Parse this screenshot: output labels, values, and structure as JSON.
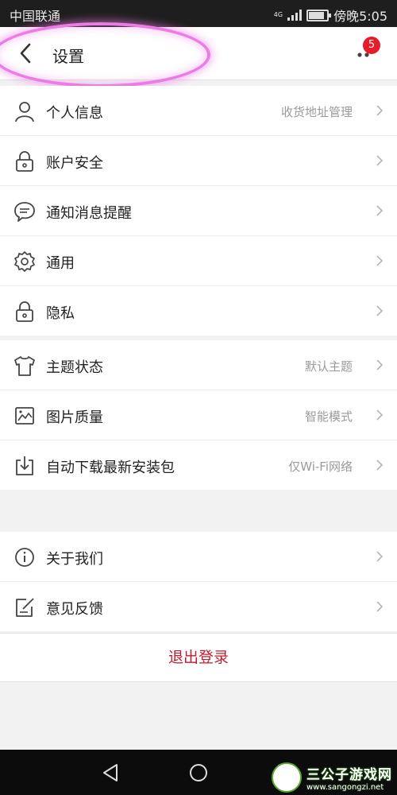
{
  "status_bar": {
    "carrier": "中国联通",
    "signal": "4G",
    "time": "傍晚5:05"
  },
  "header": {
    "title": "设置",
    "badge_count": "5"
  },
  "groups": [
    {
      "items": [
        {
          "icon": "person-icon",
          "label": "个人信息",
          "value": "收货地址管理"
        },
        {
          "icon": "lock-icon",
          "label": "账户安全",
          "value": ""
        },
        {
          "icon": "chat-bubble-icon",
          "label": "通知消息提醒",
          "value": ""
        },
        {
          "icon": "gear-icon",
          "label": "通用",
          "value": ""
        },
        {
          "icon": "lock-icon",
          "label": "隐私",
          "value": ""
        }
      ]
    },
    {
      "items": [
        {
          "icon": "tshirt-icon",
          "label": "主题状态",
          "value": "默认主题"
        },
        {
          "icon": "image-icon",
          "label": "图片质量",
          "value": "智能模式"
        },
        {
          "icon": "download-icon",
          "label": "自动下载最新安装包",
          "value": "仅Wi-Fi网络"
        }
      ]
    },
    {
      "items": [
        {
          "icon": "info-icon",
          "label": "关于我们",
          "value": ""
        },
        {
          "icon": "feedback-edit-icon",
          "label": "意见反馈",
          "value": ""
        }
      ]
    }
  ],
  "logout_label": "退出登录",
  "watermark": {
    "name": "三公子游戏网",
    "url": "www.sangongzi.net"
  },
  "colors": {
    "logout_text": "#c01d2e",
    "badge": "#e61c2a",
    "highlight_circle": "#ec7be6"
  }
}
